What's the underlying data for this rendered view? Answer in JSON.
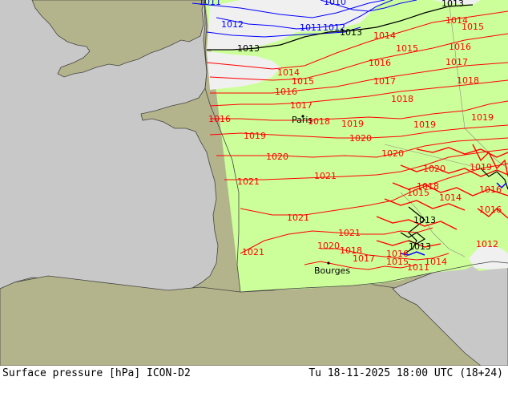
{
  "footer": {
    "title": "Surface pressure [hPa] ICON-D2",
    "datetime": "Tu 18-11-2025 18:00 UTC (18+24)"
  },
  "colors": {
    "sea": "#c8c8c8",
    "land": "#b4b48c",
    "model_domain": "#ccff99",
    "isobar_high": "#ff0000",
    "isobar_mid": "#000000",
    "isobar_low": "#0000ff",
    "coast": "#444444"
  },
  "cities": [
    {
      "name": "Paris"
    },
    {
      "name": "Bourges"
    }
  ],
  "isobars": [
    {
      "value": "1011"
    },
    {
      "value": "1010"
    },
    {
      "value": "1012"
    },
    {
      "value": "1011"
    },
    {
      "value": "1012"
    },
    {
      "value": "1013"
    },
    {
      "value": "1013"
    },
    {
      "value": "1013"
    },
    {
      "value": "1014"
    },
    {
      "value": "1014"
    },
    {
      "value": "1015"
    },
    {
      "value": "1014"
    },
    {
      "value": "1015"
    },
    {
      "value": "1016"
    },
    {
      "value": "1016"
    },
    {
      "value": "1015"
    },
    {
      "value": "1017"
    },
    {
      "value": "1016"
    },
    {
      "value": "1017"
    },
    {
      "value": "1018"
    },
    {
      "value": "1018"
    },
    {
      "value": "1016"
    },
    {
      "value": "1017"
    },
    {
      "value": "1018"
    },
    {
      "value": "1019"
    },
    {
      "value": "1019"
    },
    {
      "value": "1019"
    },
    {
      "value": "1019"
    },
    {
      "value": "1020"
    },
    {
      "value": "1020"
    },
    {
      "value": "1020"
    },
    {
      "value": "1021"
    },
    {
      "value": "1021"
    },
    {
      "value": "1021"
    },
    {
      "value": "1021"
    },
    {
      "value": "1021"
    },
    {
      "value": "1020"
    },
    {
      "value": "1018"
    },
    {
      "value": "1017"
    },
    {
      "value": "1016"
    },
    {
      "value": "1015"
    },
    {
      "value": "1014"
    },
    {
      "value": "1013"
    },
    {
      "value": "1013"
    },
    {
      "value": "1016"
    },
    {
      "value": "1015"
    },
    {
      "value": "1011"
    },
    {
      "value": "1018"
    },
    {
      "value": "1016"
    },
    {
      "value": "1020"
    },
    {
      "value": "1019"
    },
    {
      "value": "1014"
    },
    {
      "value": "1012"
    }
  ]
}
